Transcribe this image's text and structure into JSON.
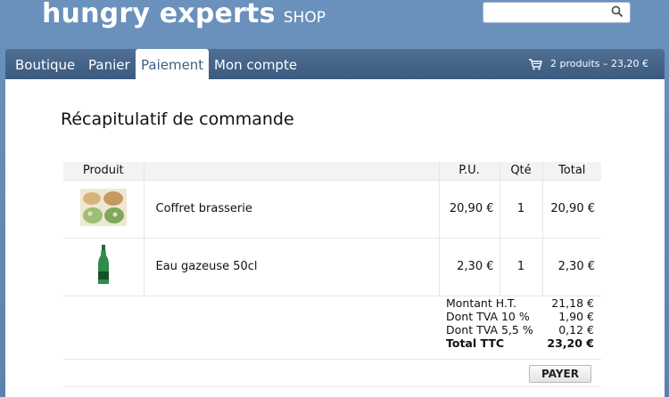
{
  "brand": {
    "name": "hungry experts",
    "suffix": "SHOP"
  },
  "search": {
    "placeholder": "",
    "icon": "search-icon"
  },
  "nav": {
    "items": [
      {
        "label": "Boutique"
      },
      {
        "label": "Panier"
      },
      {
        "label": "Paiement",
        "active": true
      },
      {
        "label": "Mon compte"
      }
    ],
    "cart_summary": "2 produits – 23,20 €"
  },
  "order": {
    "title": "Récapitulatif de commande",
    "headers": {
      "product": "Produit",
      "unit_price": "P.U.",
      "qty": "Qté",
      "total": "Total"
    },
    "rows": [
      {
        "name": "Coffret brasserie",
        "unit_price": "20,90 €",
        "qty": "1",
        "total": "20,90 €",
        "image": "meal-box-image"
      },
      {
        "name": "Eau gazeuse 50cl",
        "unit_price": "2,30 €",
        "qty": "1",
        "total": "2,30 €",
        "image": "water-bottle-image"
      }
    ],
    "summary": [
      {
        "label": "Montant H.T.",
        "value": "21,18 €"
      },
      {
        "label": "Dont TVA 10 %",
        "value": "1,90 €"
      },
      {
        "label": "Dont TVA 5,5 %",
        "value": "0,12 €"
      },
      {
        "label": "Total TTC",
        "value": "23,20 €"
      }
    ],
    "pay_button": "PAYER"
  },
  "colors": {
    "header_bg": "#6b91bd",
    "navbar": "#3b5a7e",
    "active_tab_text": "#3d5f86"
  }
}
